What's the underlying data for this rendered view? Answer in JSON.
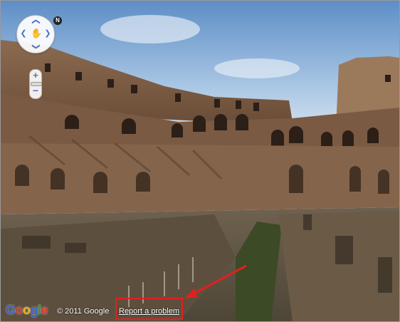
{
  "colors": {
    "annotation_red": "#e02020",
    "google_blue": "#3a63c9",
    "google_red": "#d23a2a",
    "google_yellow": "#e8b21e",
    "google_green": "#2f9a3e",
    "control_blue": "#5570c0"
  },
  "controls": {
    "pan_up": "❮",
    "pan_down": "❯",
    "pan_left": "❮",
    "pan_right": "❯",
    "pan_icon": "hand-icon",
    "compass_label": "N",
    "zoom_in": "+",
    "zoom_out": "−"
  },
  "logo": {
    "letters": [
      "G",
      "o",
      "o",
      "g",
      "l",
      "e"
    ]
  },
  "footer": {
    "copyright": "© 2011 Google",
    "report_link": "Report a problem"
  }
}
